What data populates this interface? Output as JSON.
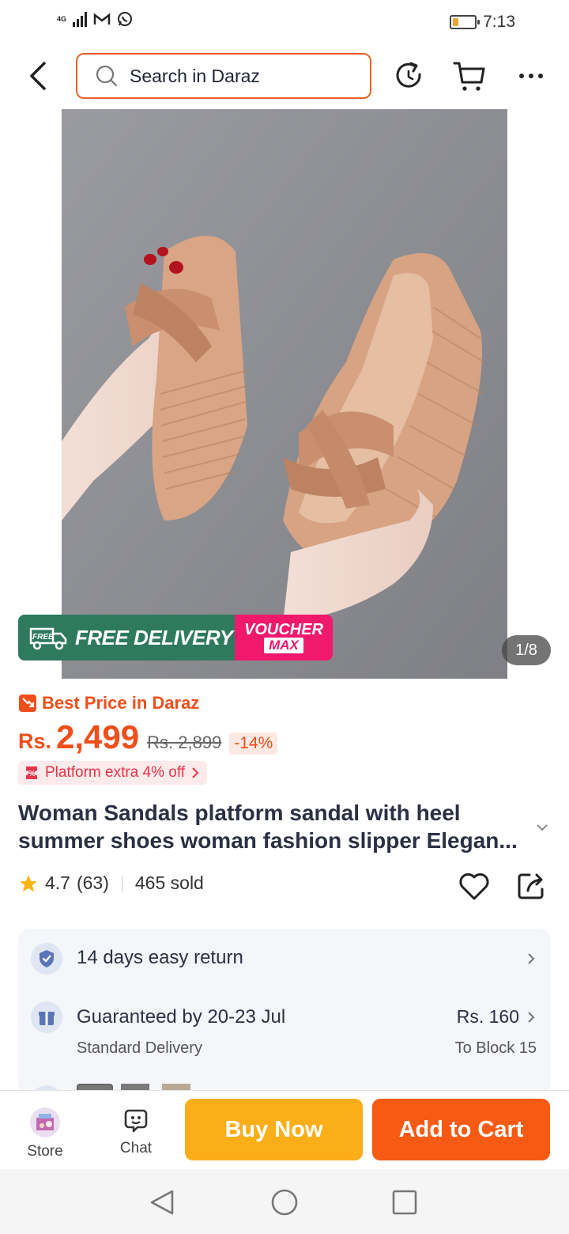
{
  "status_bar": {
    "network": "4G",
    "time": "7:13",
    "battery_level": 0.25
  },
  "search": {
    "placeholder": "Search in Daraz"
  },
  "gallery": {
    "banner": {
      "free_badge": "FREE",
      "delivery_text": "FREE DELIVERY",
      "voucher_line1": "VOUCHER",
      "voucher_line2": "MAX"
    },
    "counter": "1/8"
  },
  "pricing": {
    "best_price_label": "Best Price in Daraz",
    "currency": "Rs.",
    "current": "2,499",
    "original": "Rs. 2,899",
    "discount": "-14%",
    "platform_offer": "Platform extra 4% off"
  },
  "product": {
    "title": "Woman Sandals platform sandal with heel summer shoes woman fashion slipper Elegan...",
    "rating": "4.7",
    "reviews": "(63)",
    "sold": "465 sold"
  },
  "services": {
    "return_text": "14 days easy return",
    "delivery_title": "Guaranteed by 20-23 Jul",
    "delivery_type": "Standard Delivery",
    "delivery_fee": "Rs. 160",
    "delivery_location": "To Block 15"
  },
  "bottom_bar": {
    "store_label": "Store",
    "chat_label": "Chat",
    "buy_now": "Buy Now",
    "add_to_cart": "Add to Cart"
  },
  "colors": {
    "brand_orange": "#f75a13",
    "buy_yellow": "#fbae18",
    "price_orange": "#f04e1a",
    "delivery_green": "#2f7a5f",
    "voucher_pink": "#f0196c"
  }
}
